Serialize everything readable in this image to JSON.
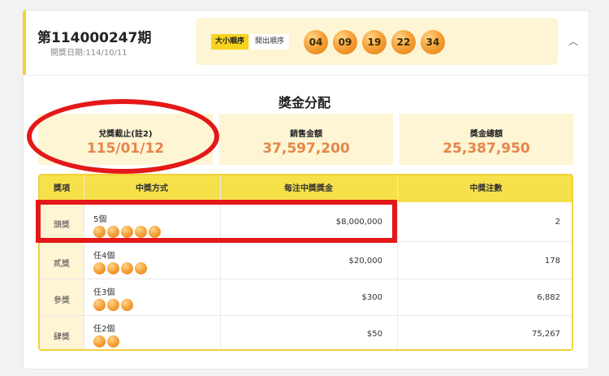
{
  "draw": {
    "number": "第114000247期",
    "date": "開獎日期:114/10/11"
  },
  "order_buttons": {
    "size_order": "大小順序",
    "draw_order": "開出順序"
  },
  "balls": [
    "04",
    "09",
    "19",
    "22",
    "34"
  ],
  "section_title": "獎金分配",
  "stats": [
    {
      "label": "兌獎截止(註2)",
      "value": "115/01/12"
    },
    {
      "label": "銷售金額",
      "value": "37,597,200"
    },
    {
      "label": "獎金總額",
      "value": "25,387,950"
    }
  ],
  "table": {
    "headers": [
      "獎項",
      "中獎方式",
      "每注中獎獎金",
      "中獎注數"
    ],
    "rows": [
      {
        "name": "頭獎",
        "method": "5個",
        "balls": 5,
        "amount": "$8,000,000",
        "count": "2"
      },
      {
        "name": "貳獎",
        "method": "任4個",
        "balls": 4,
        "amount": "$20,000",
        "count": "178"
      },
      {
        "name": "參獎",
        "method": "任3個",
        "balls": 3,
        "amount": "$300",
        "count": "6,882"
      },
      {
        "name": "肆獎",
        "method": "任2個",
        "balls": 2,
        "amount": "$50",
        "count": "75,267"
      }
    ]
  },
  "colors": {
    "accent_yellow": "#f6d31d",
    "panel_cream": "#fdf5d4",
    "value_orange": "#e6864a",
    "annotation_red": "#e41818"
  }
}
